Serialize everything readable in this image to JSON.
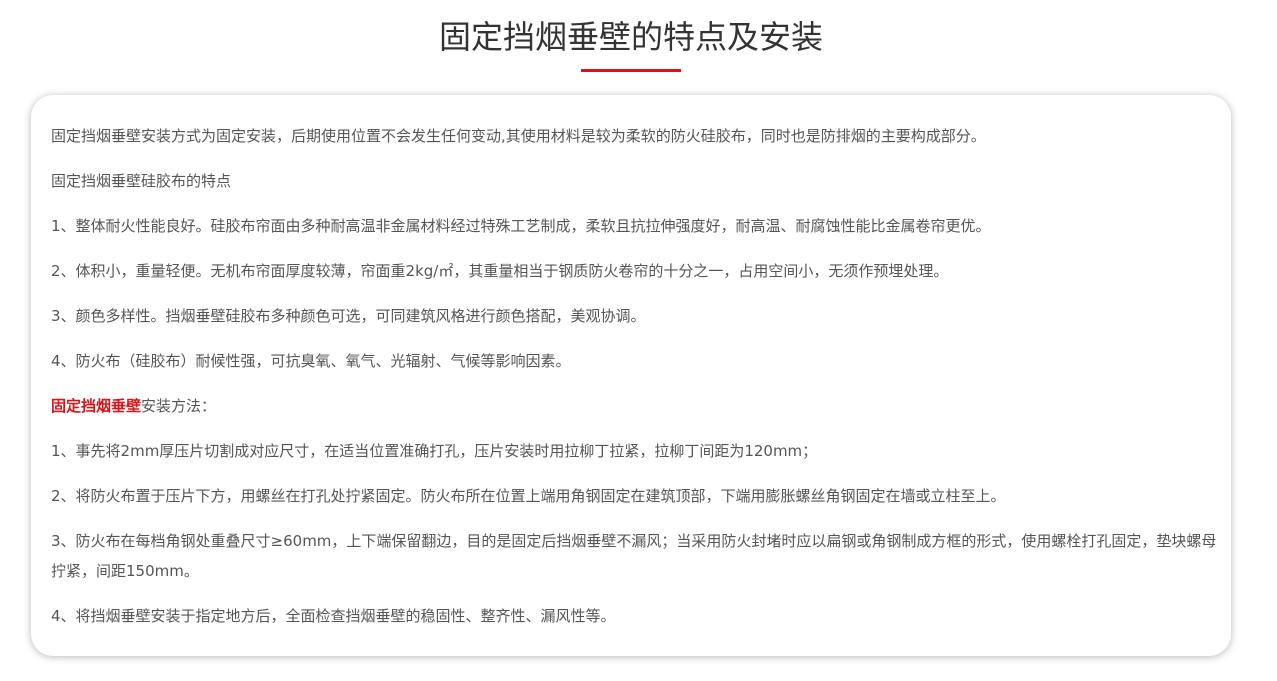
{
  "page": {
    "title": "固定挡烟垂壁的特点及安装",
    "accent_color": "#d7161c"
  },
  "content": {
    "intro": "固定挡烟垂壁安装方式为固定安装，后期使用位置不会发生任何变动,其使用材料是较为柔软的防火硅胶布，同时也是防排烟的主要构成部分。",
    "features_heading": "固定挡烟垂壁硅胶布的特点",
    "features": [
      "1、整体耐火性能良好。硅胶布帘面由多种耐高温非金属材料经过特殊工艺制成，柔软且抗拉伸强度好，耐高温、耐腐蚀性能比金属卷帘更优。",
      "2、体积小，重量轻便。无机布帘面厚度较薄，帘面重2kg/㎡，其重量相当于钢质防火卷帘的十分之一，占用空间小，无须作预埋处理。",
      "3、颜色多样性。挡烟垂壁硅胶布多种颜色可选，可同建筑风格进行颜色搭配，美观协调。",
      "4、防火布（硅胶布）耐候性强，可抗臭氧、氧气、光辐射、气候等影响因素。"
    ],
    "install_heading_highlight": "固定挡烟垂壁",
    "install_heading_rest": "安装方法：",
    "install_steps": [
      "1、事先将2mm厚压片切割成对应尺寸，在适当位置准确打孔，压片安装时用拉柳丁拉紧，拉柳丁间距为120mm；",
      "2、将防火布置于压片下方，用螺丝在打孔处拧紧固定。防火布所在位置上端用角钢固定在建筑顶部，下端用膨胀螺丝角钢固定在墙或立柱至上。",
      "3、防火布在每档角钢处重叠尺寸≥60mm，上下端保留翻边，目的是固定后挡烟垂壁不漏风；当采用防火封堵时应以扁钢或角钢制成方框的形式，使用螺栓打孔固定，垫块螺母拧紧，间距150mm。",
      "4、将挡烟垂壁安装于指定地方后，全面检查挡烟垂壁的稳固性、整齐性、漏风性等。"
    ]
  }
}
